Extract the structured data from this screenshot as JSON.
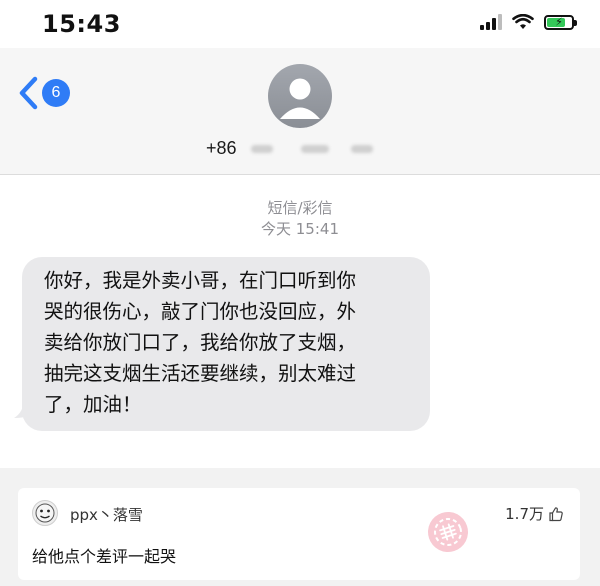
{
  "status_bar": {
    "time": "15:43",
    "icons": [
      "signal-icon",
      "wifi-icon",
      "battery-charging-icon"
    ],
    "battery_level": 0.75
  },
  "header": {
    "back_badge_count": "6",
    "contact_prefix": "+86",
    "avatar_icon": "person-placeholder-icon"
  },
  "thread": {
    "service_label": "短信/彩信",
    "timestamp": "今天 15:41"
  },
  "message": {
    "lines": [
      "你好，我是外卖小哥，在门口听到你",
      "哭的很伤心，敲了门你也没回应，外",
      "卖给你放门口了，我给你放了支烟，",
      "抽完这支烟生活还要继续，别太难过",
      "了，加油！"
    ]
  },
  "comment": {
    "username": "ppx丶落雪",
    "likes": "1.7万",
    "text": "给他点个差评一起哭",
    "like_icon": "thumbs-up-icon",
    "watermark_text": "神评"
  },
  "colors": {
    "ios_blue": "#2f7cf6",
    "bubble_gray": "#e9e9eb",
    "meta_gray": "#8e8e93",
    "battery_green": "#34c759",
    "watermark_pink": "#f6b8c4"
  }
}
